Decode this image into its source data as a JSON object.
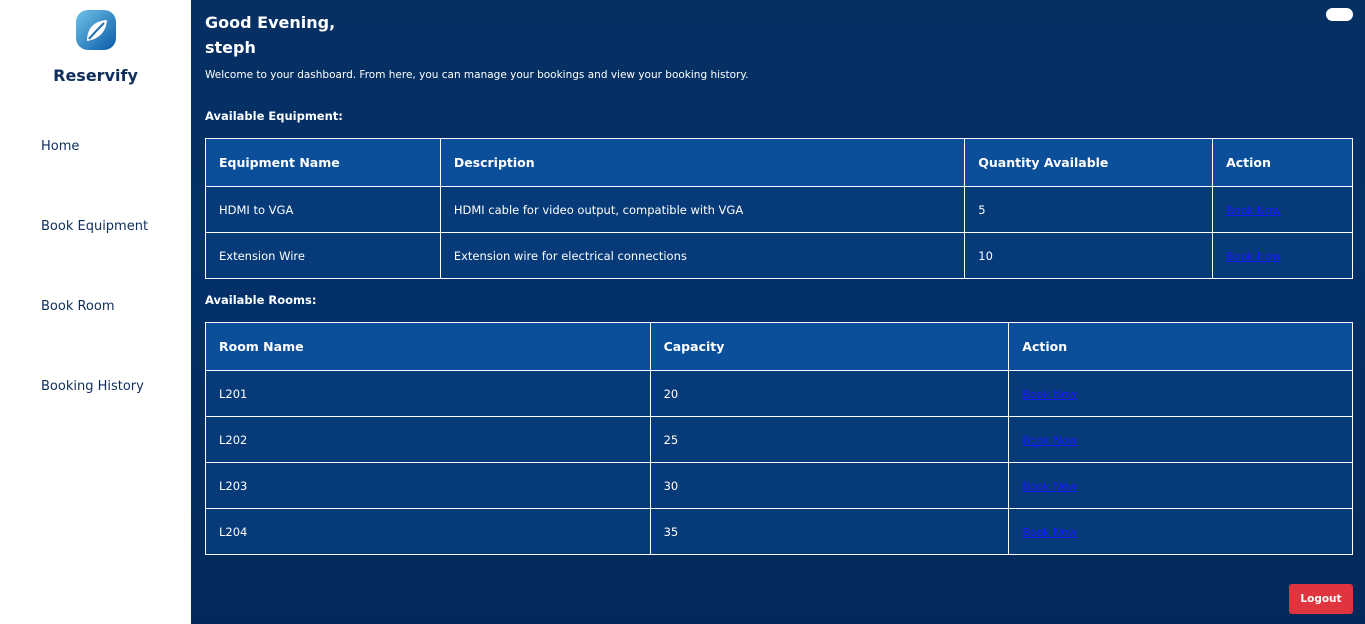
{
  "sidebar": {
    "brand": "Reservify",
    "nav": [
      {
        "label": "Home"
      },
      {
        "label": "Book Equipment"
      },
      {
        "label": "Book Room"
      },
      {
        "label": "Booking History"
      }
    ]
  },
  "main": {
    "greeting_line1": "Good Evening,",
    "greeting_line2": "steph",
    "welcome": "Welcome to your dashboard. From here, you can manage your bookings and view your booking history.",
    "equipment_title": "Available Equipment:",
    "equipment_headers": [
      "Equipment Name",
      "Description",
      "Quantity Available",
      "Action"
    ],
    "equipment_rows": [
      {
        "name": "HDMI to VGA",
        "description": "HDMI cable for video output, compatible with VGA",
        "quantity": "5",
        "action": "Book Now"
      },
      {
        "name": "Extension Wire",
        "description": "Extension wire for electrical connections",
        "quantity": "10",
        "action": "Book Now"
      }
    ],
    "rooms_title": "Available Rooms:",
    "rooms_headers": [
      "Room Name",
      "Capacity",
      "Action"
    ],
    "rooms_rows": [
      {
        "name": "L201",
        "capacity": "20",
        "action": "Book Now"
      },
      {
        "name": "L202",
        "capacity": "25",
        "action": "Book Now"
      },
      {
        "name": "L203",
        "capacity": "30",
        "action": "Book Now"
      },
      {
        "name": "L204",
        "capacity": "35",
        "action": "Book Now"
      }
    ],
    "logout_label": "Logout"
  },
  "icons": {
    "logo": "leaf-logo-icon"
  },
  "colors": {
    "accent": "#0b4e99",
    "logout": "#e0353f",
    "link": "#1a1aff"
  }
}
